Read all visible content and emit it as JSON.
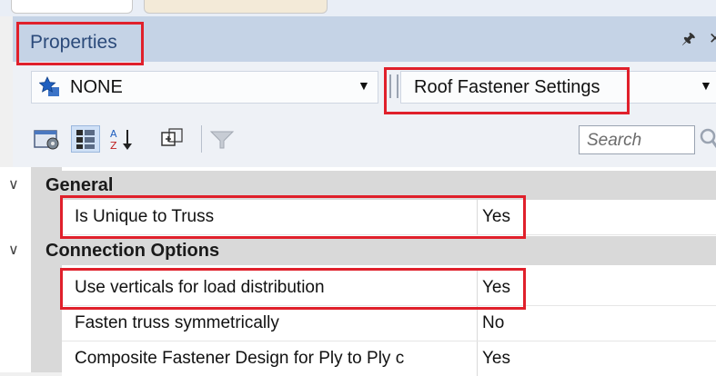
{
  "panel": {
    "title": "Properties",
    "pin_icon": "pin-icon",
    "close_icon": "close-icon"
  },
  "selectors": {
    "object_value": "NONE",
    "object_icon": "star-icon",
    "settings_value": "Roof Fastener Settings"
  },
  "toolbar": {
    "search_placeholder": "Search",
    "buttons": [
      "categorized-view-icon",
      "properties-grid-icon",
      "sort-alphabetical-icon",
      "expand-icon",
      "filter-icon"
    ]
  },
  "grid": {
    "categories": [
      {
        "label": "General",
        "properties": [
          {
            "name": "Is Unique to Truss",
            "value": "Yes"
          }
        ]
      },
      {
        "label": "Connection Options",
        "properties": [
          {
            "name": "Use verticals for load distribution",
            "value": "Yes"
          },
          {
            "name": "Fasten truss symmetrically",
            "value": "No"
          },
          {
            "name": "Composite Fastener Design for Ply to Ply c",
            "value": "Yes"
          }
        ]
      }
    ]
  },
  "colors": {
    "highlight": "#e0202b",
    "title_bar": "#c5d3e6",
    "title_text": "#2b4a7a"
  }
}
